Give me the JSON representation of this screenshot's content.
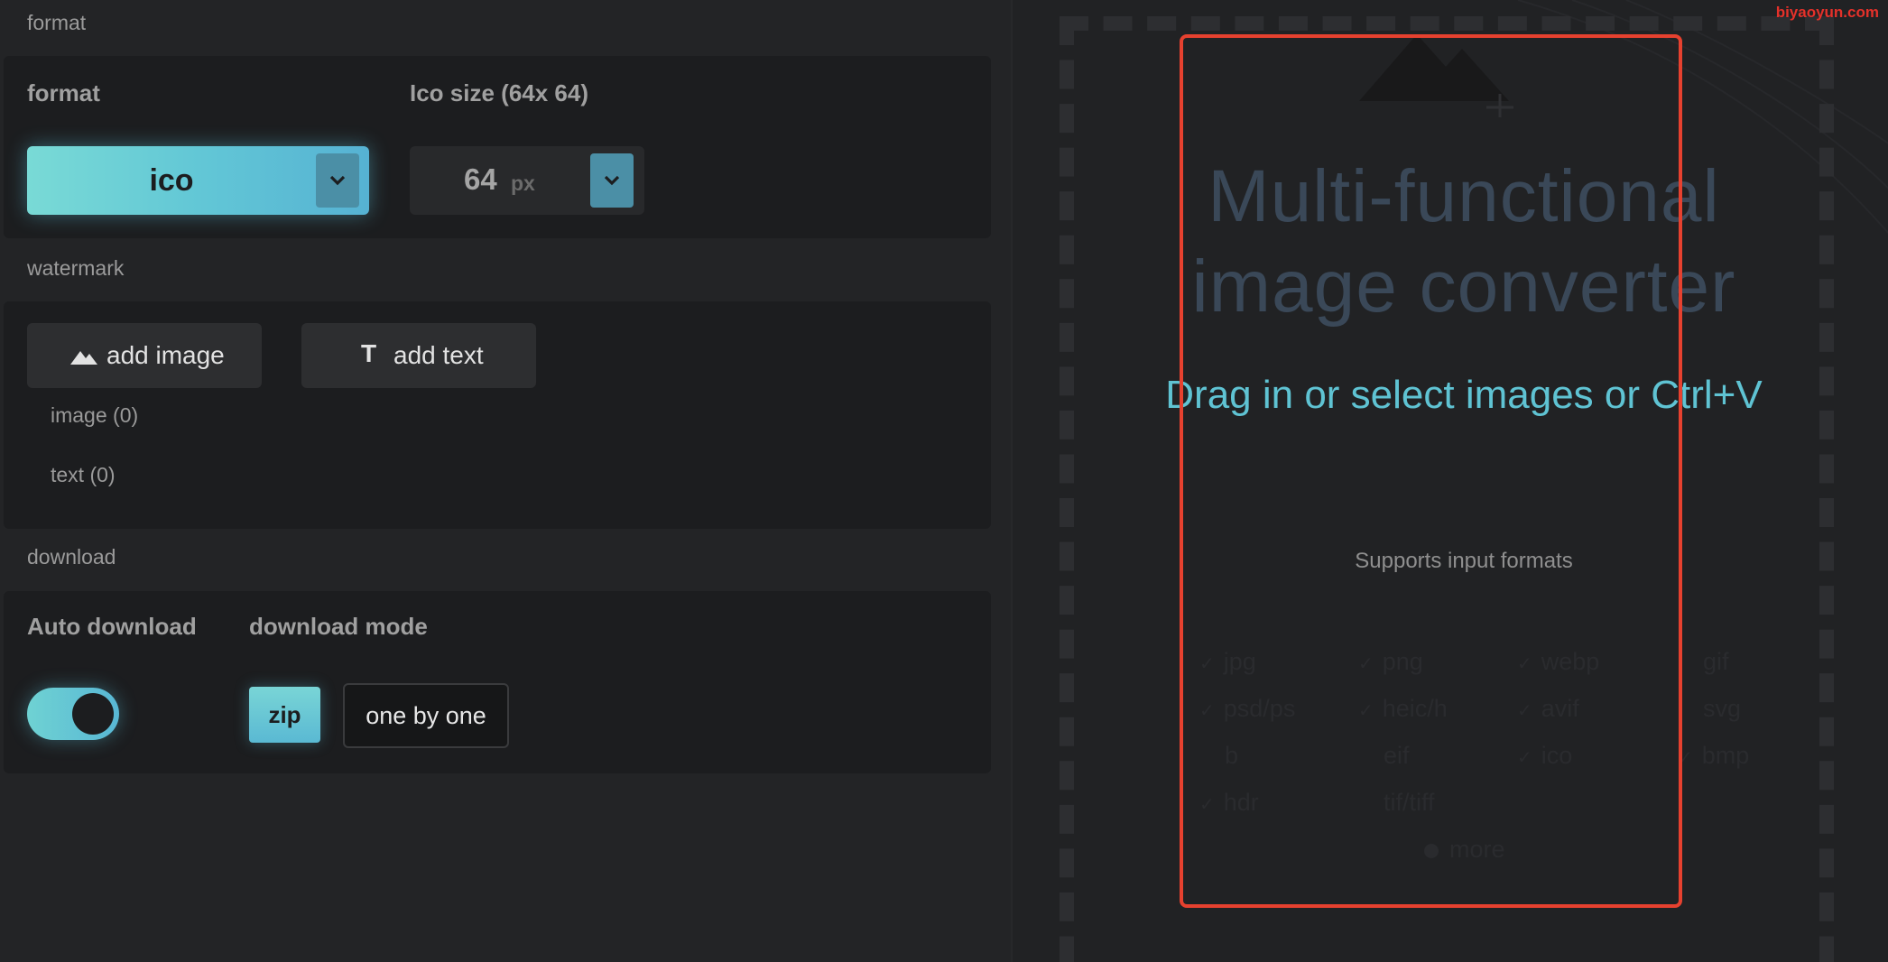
{
  "settings": {
    "format_section": {
      "title": "format",
      "format_label": "format",
      "format_value": "ico",
      "size_label": "Ico size (64x 64)",
      "size_value": "64",
      "size_unit": "px"
    },
    "watermark_section": {
      "title": "watermark",
      "add_image_label": "add image",
      "add_text_label": "add text",
      "image_count": "image (0)",
      "text_count": "text (0)"
    },
    "download_section": {
      "title": "download",
      "auto_download_label": "Auto download",
      "auto_download_on": true,
      "mode_label": "download mode",
      "mode_zip": "zip",
      "mode_one_by_one": "one by one",
      "selected_mode": "zip"
    }
  },
  "dropzone": {
    "title": "Multi-functional image converter",
    "instruction": "Drag in or select images or Ctrl+V",
    "supports_label": "Supports input formats",
    "formats": [
      "jpg",
      "png",
      "webp",
      "gif",
      "psd/ps",
      "heic/h",
      "avif",
      "svg",
      "b",
      "eif",
      "ico",
      "bmp",
      "hdr",
      "tif/tiff"
    ],
    "more_label": "more"
  },
  "watermark_text": "biyaoyun.com",
  "colors": {
    "accent": "#5fc3d3",
    "highlight_box": "#e6412f",
    "background": "#232426"
  }
}
